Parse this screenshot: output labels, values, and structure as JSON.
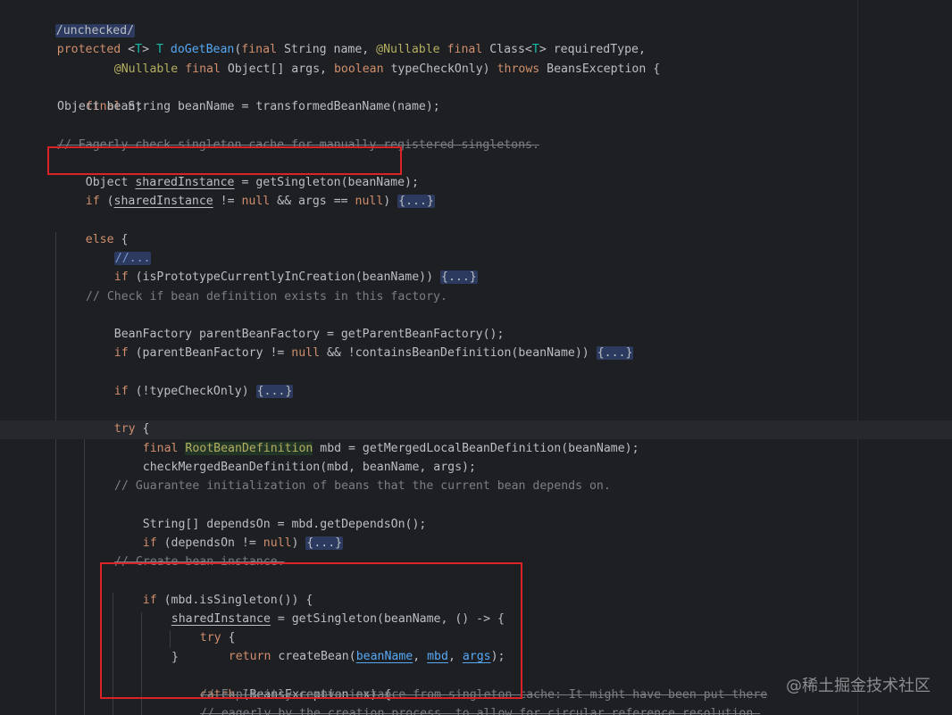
{
  "lines": [
    "/unchecked/",
    "protected <T> T doGetBean(final String name, @Nullable final Class<T> requiredType,",
    "@Nullable final Object[] args, boolean typeCheckOnly) throws BeansException {",
    "final String beanName = transformedBeanName(name);",
    "Object bean;",
    "// Eagerly check singleton cache for manually registered singletons.",
    "Object sharedInstance = getSingleton(beanName);",
    "if (sharedInstance != null && args == null) {...}",
    "else {",
    "//...",
    "if (isPrototypeCurrentlyInCreation(beanName)) {...}",
    "// Check if bean definition exists in this factory.",
    "BeanFactory parentBeanFactory = getParentBeanFactory();",
    "if (parentBeanFactory != null && !containsBeanDefinition(beanName)) {...}",
    "if (!typeCheckOnly) {...}",
    "try {",
    "final RootBeanDefinition mbd = getMergedLocalBeanDefinition(beanName);",
    "checkMergedBeanDefinition(mbd, beanName, args);",
    "// Guarantee initialization of beans that the current bean depends on.",
    "String[] dependsOn = mbd.getDependsOn();",
    "if (dependsOn != null) {...}",
    "// Create bean instance.",
    "if (mbd.isSingleton()) {",
    "sharedInstance = getSingleton(beanName, () -> {",
    "try {",
    "return createBean(beanName, mbd, args);",
    "}",
    "catch (BeansException ex) {",
    "// Explicitly remove instance from singleton cache: It might have been put there",
    "// eagerly by the creation process, to allow for circular reference resolution."
  ],
  "watermark": "@稀土掘金技术社区"
}
